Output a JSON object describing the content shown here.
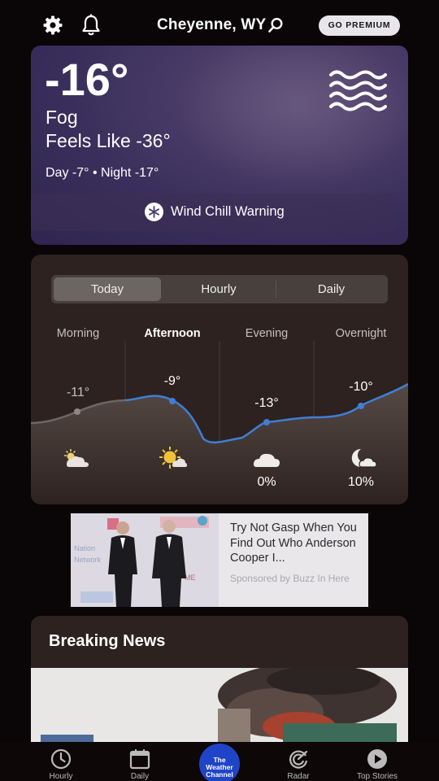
{
  "header": {
    "location": "Cheyenne, WY",
    "premium_label": "GO PREMIUM",
    "icons": [
      "gear-icon",
      "bell-icon",
      "search-icon"
    ]
  },
  "current": {
    "temperature": "-16°",
    "condition": "Fog",
    "feels_like": "Feels Like -36°",
    "day_night": "Day -7° • Night -17°",
    "icon": "fog-icon",
    "alert": {
      "label": "Wind Chill Warning",
      "icon": "snowflake-icon"
    },
    "colors": {
      "card": "#3a2f5c"
    }
  },
  "forecast": {
    "tabs": [
      {
        "label": "Today",
        "active": true
      },
      {
        "label": "Hourly",
        "active": false
      },
      {
        "label": "Daily",
        "active": false
      }
    ],
    "periods": [
      {
        "name": "Morning",
        "temp": "-11°",
        "icon": "partly-cloudy-sun-icon",
        "precip": "",
        "bold": false
      },
      {
        "name": "Afternoon",
        "temp": "-9°",
        "icon": "sun-cloud-icon",
        "precip": "",
        "bold": true
      },
      {
        "name": "Evening",
        "temp": "-13°",
        "icon": "cloud-icon",
        "precip": "0%",
        "bold": false
      },
      {
        "name": "Overnight",
        "temp": "-10°",
        "icon": "moon-cloud-icon",
        "precip": "10%",
        "bold": false
      }
    ],
    "colors": {
      "line": "#3f7fd6",
      "card": "#2d221f"
    }
  },
  "ad": {
    "headline": "Try Not Gasp When You Find Out Who Anderson Cooper I...",
    "sponsor": "Sponsored by Buzz In Here"
  },
  "news": {
    "title": "Breaking News"
  },
  "bottom_nav": {
    "items": [
      {
        "label": "Hourly",
        "icon": "clock-icon"
      },
      {
        "label": "Daily",
        "icon": "calendar-icon"
      },
      {
        "label": "The Weather Channel",
        "icon": "weather-channel-logo"
      },
      {
        "label": "Radar",
        "icon": "radar-icon"
      },
      {
        "label": "Top Stories",
        "icon": "play-icon"
      }
    ]
  }
}
